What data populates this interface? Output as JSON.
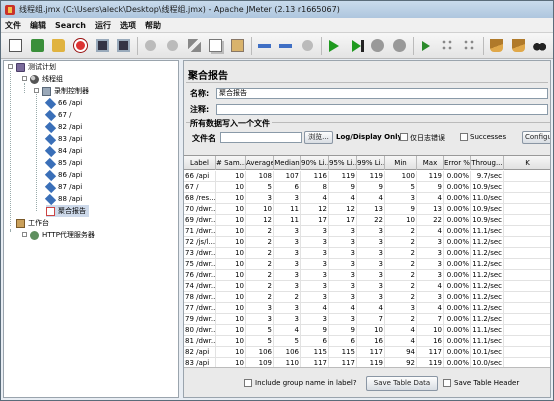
{
  "window": {
    "title": "线程组.jmx (C:\\Users\\aleck\\Desktop\\线程组.jmx) - Apache JMeter (2.13 r1665067)"
  },
  "menu": [
    "文件",
    "编辑",
    "Search",
    "运行",
    "选项",
    "帮助"
  ],
  "toolbar": {
    "icons": [
      "new-icon",
      "templates-icon",
      "open-icon",
      "close-icon",
      "save-icon",
      "save-as-icon",
      "undo-icon",
      "redo-icon",
      "cut-icon",
      "copy-icon",
      "paste-icon",
      "expand-icon",
      "collapse-icon",
      "toggle-icon",
      "start-icon",
      "start-no-pause-icon",
      "stop-icon",
      "shutdown-icon",
      "remote-start-icon",
      "remote-stop-icon",
      "remote-exit-icon",
      "clear-icon",
      "clear-all-icon",
      "search-icon"
    ]
  },
  "tree": {
    "test_plan": "测试计划",
    "thread_group": "线程组",
    "loop_controller": "录制控制器",
    "samplers": [
      "66 /api",
      "67 /",
      "82 /api",
      "83 /api",
      "84 /api",
      "85 /api",
      "86 /api",
      "87 /api",
      "88 /api"
    ],
    "selected_listener": "聚合报告",
    "workbench": "工作台",
    "proxy": "HTTP代理服务器"
  },
  "panel": {
    "title": "聚合报告",
    "name_label": "名称:",
    "name_value": "聚合报告",
    "comment_label": "注释:",
    "comment_value": "",
    "write_all_label": "所有数据写入一个文件",
    "filename_label": "文件名",
    "filename_value": "",
    "browse_label": "浏览...",
    "log_display_label": "Log/Display Only:",
    "errors_only_label": "仅日志错误",
    "successes_label": "Successes",
    "configure_label": "Configure",
    "include_group_label": "Include group name in label?",
    "save_table_label": "Save Table Data",
    "save_header_label": "Save Table Header"
  },
  "table": {
    "columns": [
      "Label",
      "# Sam...",
      "Average",
      "Median",
      "90% Li...",
      "95% Li...",
      "99% Li...",
      "Min",
      "Max",
      "Error %",
      "Throug...",
      "K"
    ],
    "rows": [
      [
        "66 /api",
        "10",
        "108",
        "107",
        "116",
        "119",
        "119",
        "100",
        "119",
        "0.00%",
        "9.7/sec",
        ""
      ],
      [
        "67 /",
        "10",
        "5",
        "6",
        "8",
        "9",
        "9",
        "5",
        "9",
        "0.00%",
        "10.9/sec",
        ""
      ],
      [
        "68 /res...",
        "10",
        "3",
        "3",
        "4",
        "4",
        "4",
        "3",
        "4",
        "0.00%",
        "11.0/sec",
        ""
      ],
      [
        "70 /dwr...",
        "10",
        "10",
        "11",
        "12",
        "12",
        "13",
        "9",
        "13",
        "0.00%",
        "10.9/sec",
        ""
      ],
      [
        "69 /dwr...",
        "10",
        "12",
        "11",
        "17",
        "17",
        "22",
        "10",
        "22",
        "0.00%",
        "10.9/sec",
        ""
      ],
      [
        "71 /dwr...",
        "10",
        "2",
        "3",
        "3",
        "3",
        "3",
        "2",
        "4",
        "0.00%",
        "11.1/sec",
        ""
      ],
      [
        "72 /js/l...",
        "10",
        "2",
        "3",
        "3",
        "3",
        "3",
        "2",
        "3",
        "0.00%",
        "11.2/sec",
        ""
      ],
      [
        "73 /dwr...",
        "10",
        "2",
        "3",
        "3",
        "3",
        "3",
        "2",
        "3",
        "0.00%",
        "11.2/sec",
        ""
      ],
      [
        "75 /dwr...",
        "10",
        "2",
        "3",
        "3",
        "3",
        "3",
        "2",
        "3",
        "0.00%",
        "11.2/sec",
        ""
      ],
      [
        "76 /dwr...",
        "10",
        "2",
        "3",
        "3",
        "3",
        "3",
        "2",
        "3",
        "0.00%",
        "11.2/sec",
        ""
      ],
      [
        "74 /dwr...",
        "10",
        "2",
        "3",
        "3",
        "3",
        "3",
        "2",
        "4",
        "0.00%",
        "11.2/sec",
        ""
      ],
      [
        "78 /dwr...",
        "10",
        "2",
        "2",
        "3",
        "3",
        "3",
        "2",
        "3",
        "0.00%",
        "11.2/sec",
        ""
      ],
      [
        "77 /dwr...",
        "10",
        "3",
        "3",
        "4",
        "4",
        "4",
        "3",
        "4",
        "0.00%",
        "11.2/sec",
        ""
      ],
      [
        "79 /dwr...",
        "10",
        "3",
        "3",
        "3",
        "3",
        "7",
        "2",
        "7",
        "0.00%",
        "11.2/sec",
        ""
      ],
      [
        "80 /dwr...",
        "10",
        "5",
        "4",
        "9",
        "9",
        "10",
        "4",
        "10",
        "0.00%",
        "11.1/sec",
        ""
      ],
      [
        "81 /dwr...",
        "10",
        "5",
        "5",
        "6",
        "6",
        "16",
        "4",
        "16",
        "0.00%",
        "11.1/sec",
        ""
      ],
      [
        "82 /api",
        "10",
        "106",
        "106",
        "115",
        "115",
        "117",
        "94",
        "117",
        "0.00%",
        "10.1/sec",
        ""
      ],
      [
        "83 /api",
        "10",
        "109",
        "110",
        "117",
        "117",
        "119",
        "92",
        "119",
        "0.00%",
        "10.0/sec",
        ""
      ],
      [
        "84 /api",
        "10",
        "107",
        "105",
        "115",
        "115",
        "116",
        "101",
        "116",
        "0.00%",
        "9.9/sec",
        ""
      ]
    ]
  }
}
